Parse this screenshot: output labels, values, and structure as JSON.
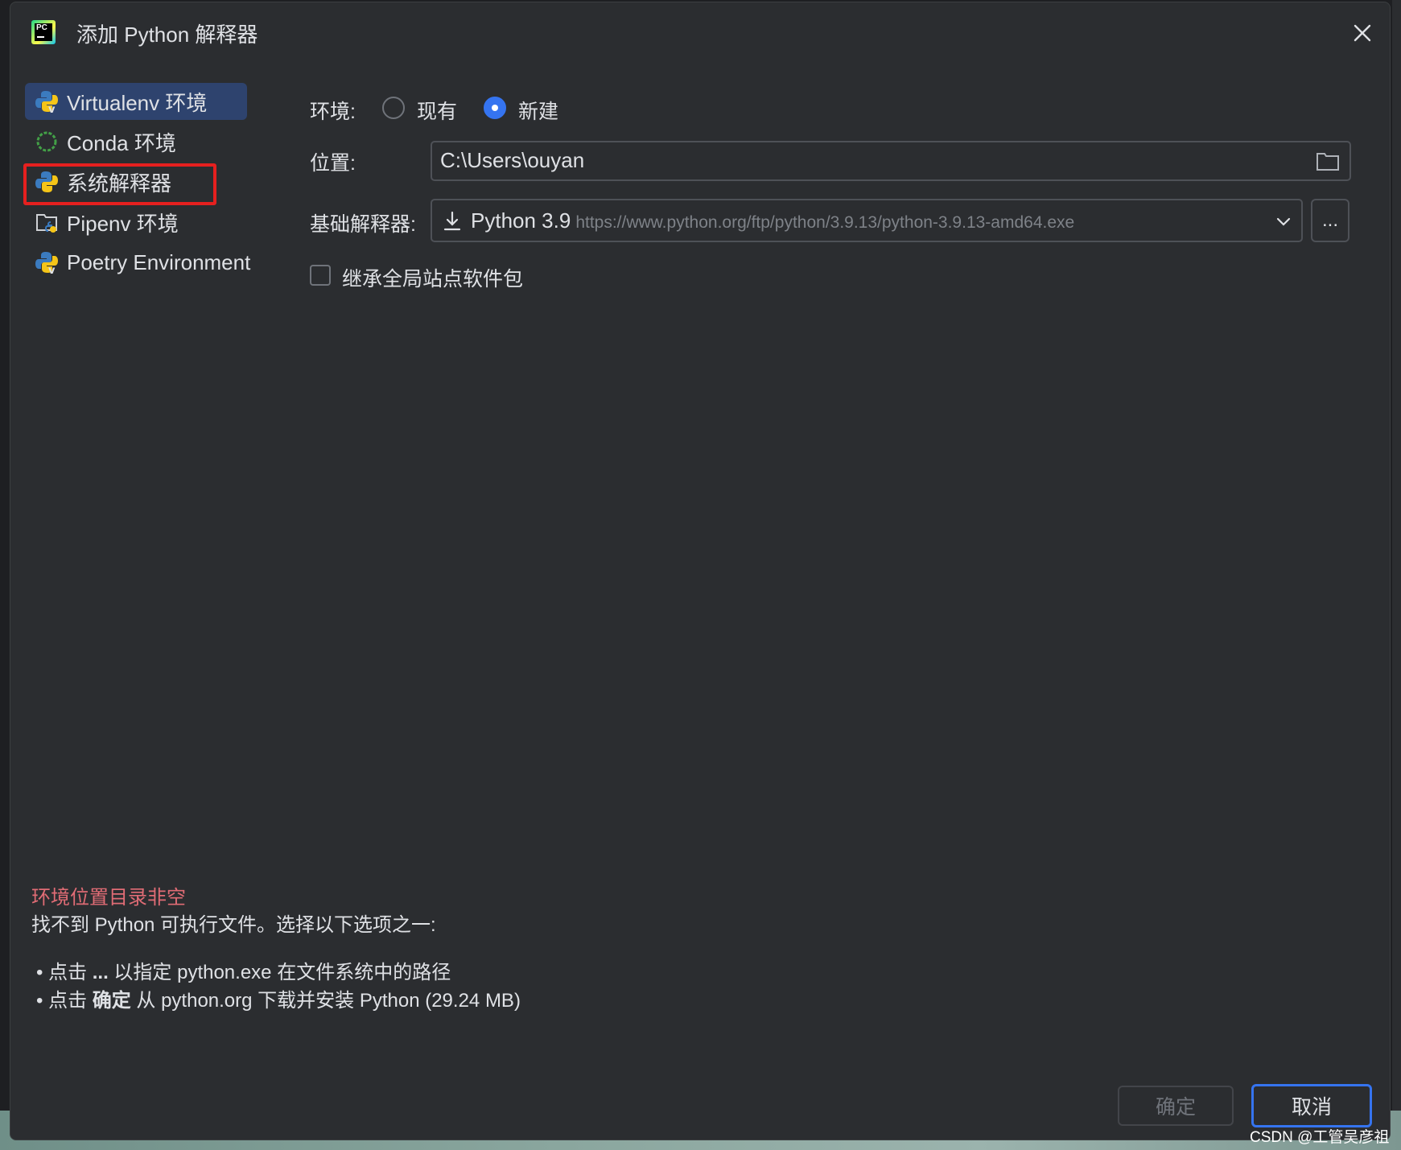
{
  "dialog": {
    "title": "添加 Python 解释器",
    "app_icon_text": "PC"
  },
  "nav": {
    "items": [
      {
        "label": "Virtualenv 环境",
        "icon": "python-virtualenv-icon"
      },
      {
        "label": "Conda 环境",
        "icon": "conda-icon"
      },
      {
        "label": "系统解释器",
        "icon": "python-icon"
      },
      {
        "label": "Pipenv 环境",
        "icon": "pipenv-folder-icon"
      },
      {
        "label": "Poetry Environment",
        "icon": "poetry-icon"
      }
    ],
    "selected_index": 0,
    "highlighted_index": 2
  },
  "form": {
    "env_label": "环境:",
    "env_options": [
      "现有",
      "新建"
    ],
    "env_selected": "新建",
    "location_label": "位置:",
    "location_value": "C:\\Users\\ouyan",
    "base_label": "基础解释器:",
    "base_value": "Python 3.9",
    "base_url": "https://www.python.org/ftp/python/3.9.13/python-3.9.13-amd64.exe",
    "browse_button": "...",
    "inherit_label": "继承全局站点软件包",
    "inherit_checked": false
  },
  "messages": {
    "error": "环境位置目录非空",
    "info": "找不到 Python 可执行文件。选择以下选项之一:",
    "bullet1_pre": "点击 ",
    "bullet1_bold": "...",
    "bullet1_post": " 以指定 python.exe 在文件系统中的路径",
    "bullet2_pre": "点击 ",
    "bullet2_bold": "确定",
    "bullet2_post": " 从 python.org 下载并安装 Python (29.24 MB)"
  },
  "buttons": {
    "ok": "确定",
    "cancel": "取消"
  },
  "watermark": "CSDN @工管吴彦祖",
  "colors": {
    "background": "#2b2d30",
    "selection": "#2e436e",
    "accent": "#3574f0",
    "error": "#e06c75",
    "highlight_box": "#e5201f"
  }
}
